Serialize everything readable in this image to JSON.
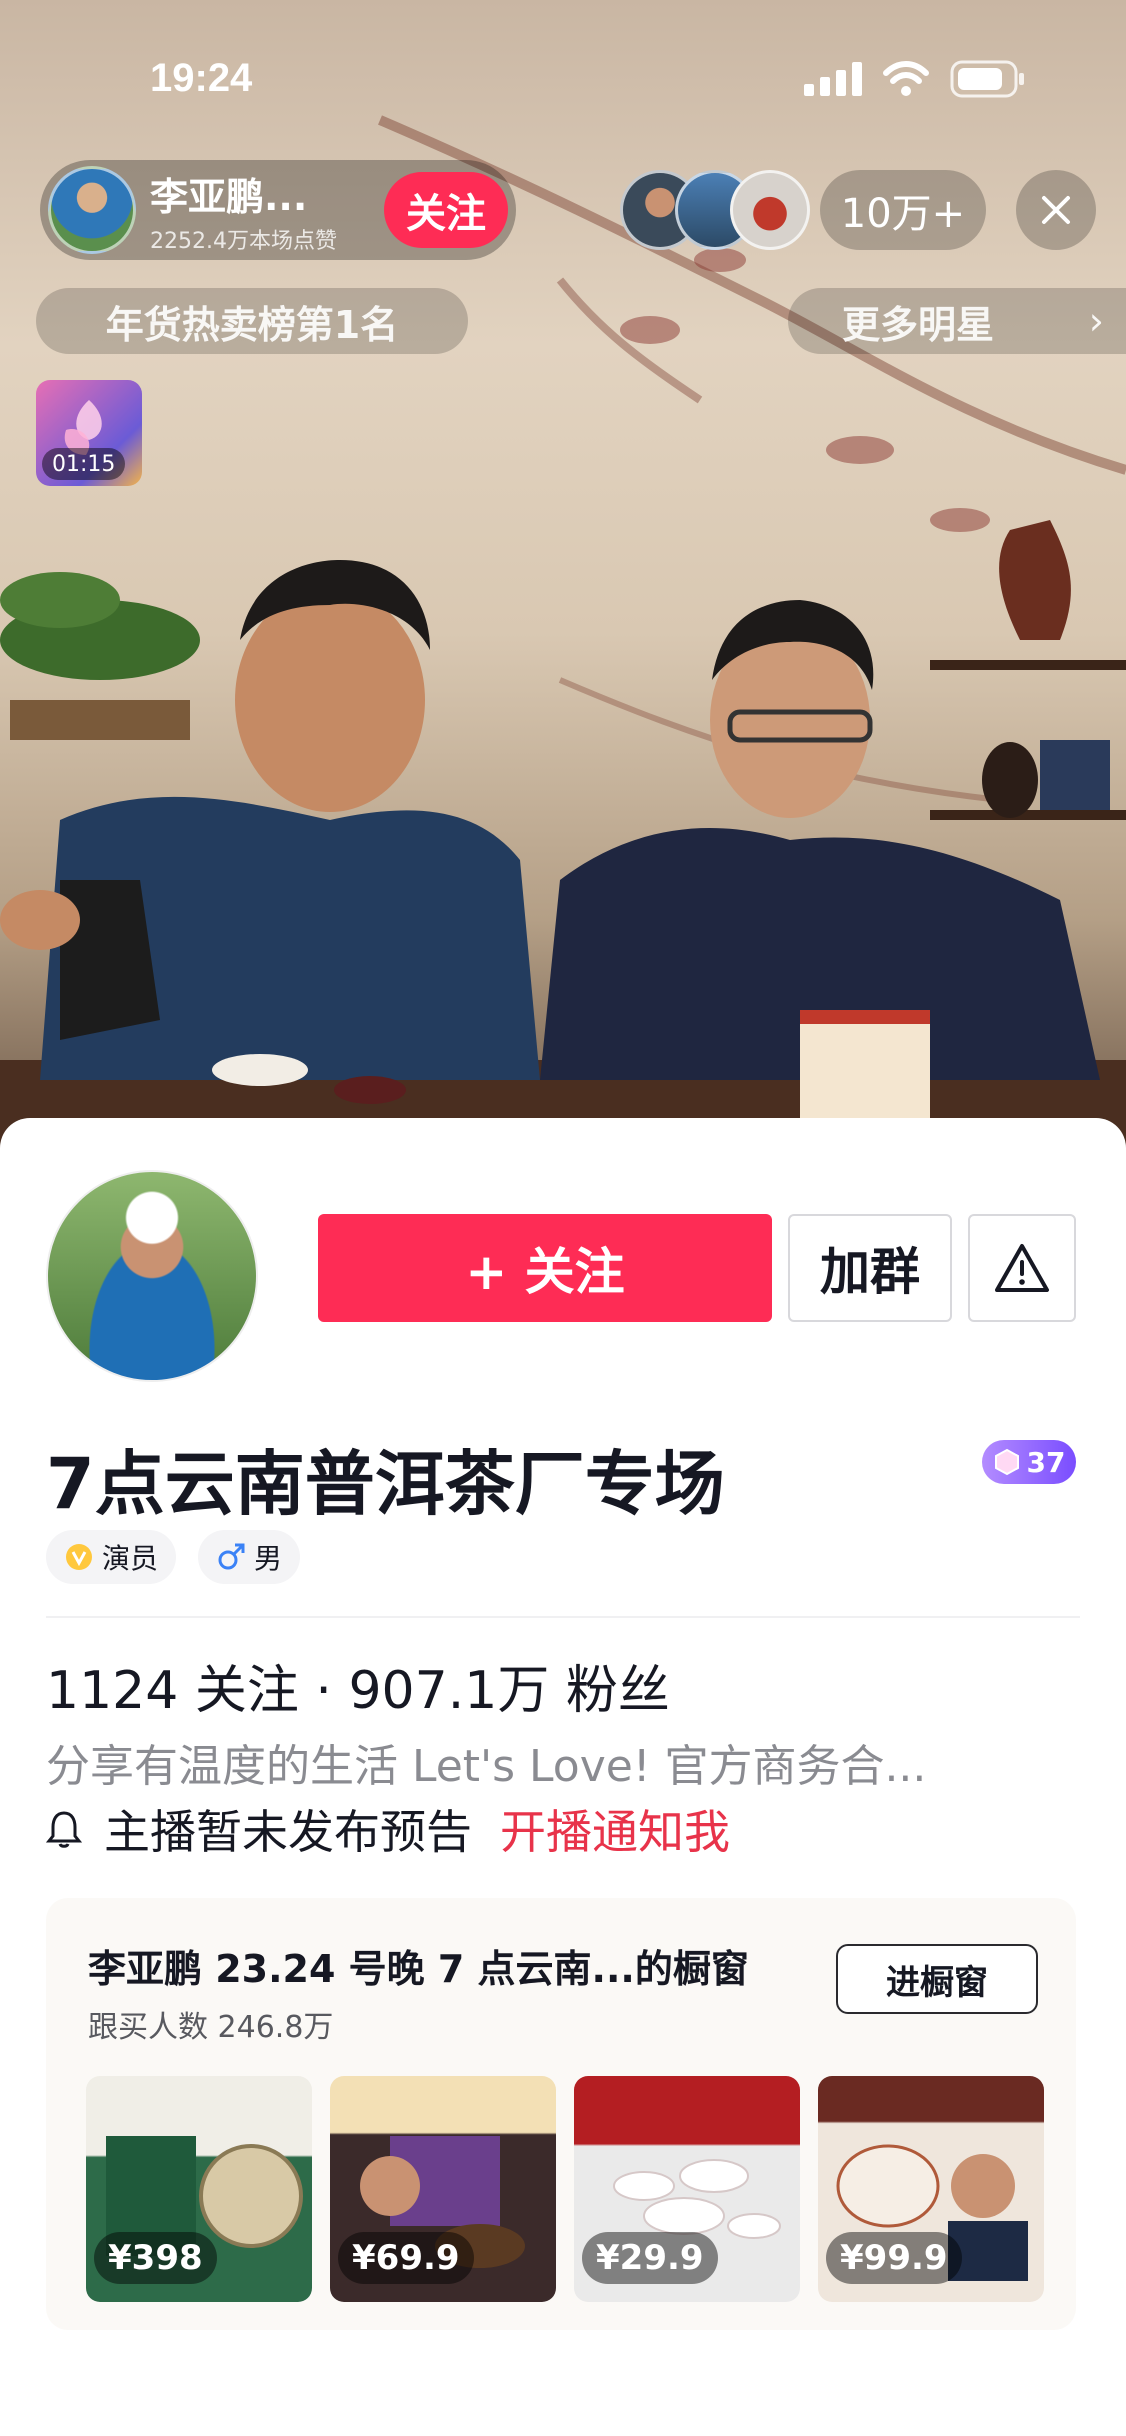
{
  "status_bar": {
    "time": "19:24"
  },
  "live": {
    "host_name": "李亚鹏...",
    "host_likes": "2252.4万本场点赞",
    "follow_label": "关注",
    "viewer_count": "10万+",
    "rank_label": "年货热卖榜第1名",
    "more_label": "更多明星",
    "mini_card_time": "01:15"
  },
  "profile": {
    "follow_button": "+ 关注",
    "group_button": "加群",
    "title": "7点云南普洱茶厂专场",
    "level": "37",
    "tags": [
      {
        "label": "演员",
        "icon": "v-badge-icon"
      },
      {
        "label": "男",
        "icon": "male-icon"
      }
    ],
    "stats": "1124 关注 · 907.1万 粉丝",
    "bio": "分享有温度的生活 Let's Love! 官方商务合...",
    "notice": "主播暂未发布预告",
    "notify_link": "开播通知我"
  },
  "shop": {
    "title": "李亚鹏 23.24 号晚 7 点云南...的橱窗",
    "subtitle": "跟买人数 246.8万",
    "enter_button": "进橱窗",
    "products": [
      {
        "price": "¥398"
      },
      {
        "price": "¥69.9"
      },
      {
        "price": "¥29.9"
      },
      {
        "price": "¥99.9"
      }
    ]
  },
  "colors": {
    "accent": "#fe2c55",
    "link": "#e8334a",
    "level_badge": "#8a5cff"
  }
}
